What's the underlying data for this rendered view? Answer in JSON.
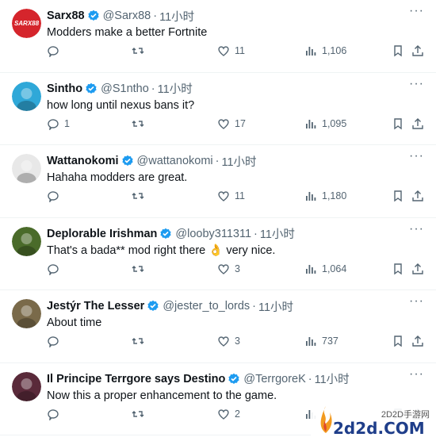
{
  "tweets": [
    {
      "name": "Sarx88",
      "handle": "@Sarx88",
      "dot": "·",
      "time": "11小时",
      "text": "Modders make a better Fortnite",
      "replies": "",
      "reposts": "",
      "likes": "11",
      "views": "1,106",
      "avatar_color": "#d5252c",
      "avatar_label": "SARX88"
    },
    {
      "name": "Sintho",
      "handle": "@S1ntho",
      "dot": "·",
      "time": "11小时",
      "text": "how long until nexus bans it?",
      "replies": "1",
      "reposts": "",
      "likes": "17",
      "views": "1,095",
      "avatar_color": "#2fa8d8",
      "avatar_label": ""
    },
    {
      "name": "Wattanokomi",
      "handle": "@wattanokomi",
      "dot": "·",
      "time": "11小时",
      "text": "Hahaha modders are great.",
      "replies": "",
      "reposts": "",
      "likes": "11",
      "views": "1,180",
      "avatar_color": "#e8e8e8",
      "avatar_label": ""
    },
    {
      "name": "Deplorable Irishman",
      "handle": "@looby311311",
      "dot": "·",
      "time": "11小时",
      "text": "That's a bada** mod right there 👌 very nice.",
      "replies": "",
      "reposts": "",
      "likes": "3",
      "views": "1,064",
      "avatar_color": "#4a6b2a",
      "avatar_label": ""
    },
    {
      "name": "Jestýr The Lesser",
      "handle": "@jester_to_lords",
      "dot": "·",
      "time": "11小时",
      "text": "About time",
      "replies": "",
      "reposts": "",
      "likes": "3",
      "views": "737",
      "avatar_color": "#7a6a4a",
      "avatar_label": ""
    },
    {
      "name": "Il Principe Terrgore says Destino",
      "handle": "@TerrgoreK",
      "dot": "·",
      "time": "11小时",
      "text": "Now this a proper enhancement to the game.",
      "replies": "",
      "reposts": "",
      "likes": "2",
      "views": "",
      "avatar_color": "#5a2a3a",
      "avatar_label": ""
    }
  ],
  "watermark": {
    "small": "2D2D手游网",
    "big": "2d2d.COM"
  },
  "colors": {
    "muted": "#536471",
    "verified": "#1d9bf0",
    "text": "#0f1419"
  }
}
